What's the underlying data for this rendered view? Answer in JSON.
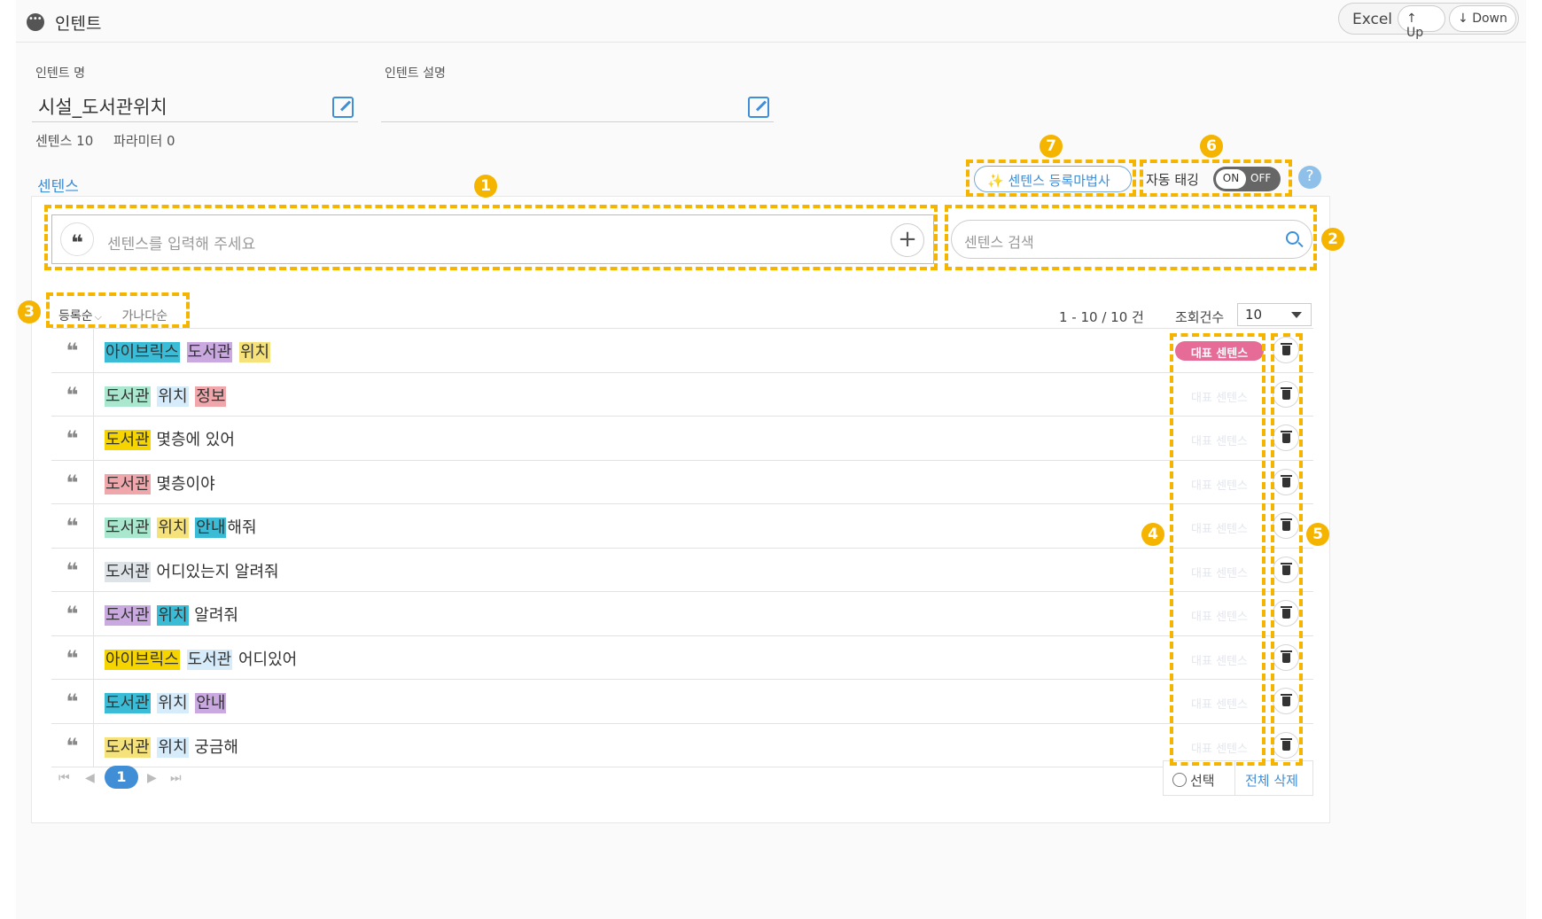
{
  "header": {
    "title": "인텐트",
    "excel_label": "Excel",
    "up_label": "Up",
    "down_label": "Down",
    "up_arrow": "↑",
    "down_arrow": "↓"
  },
  "intent": {
    "name_label": "인텐트 명",
    "name_value": "시설_도서관위치",
    "desc_label": "인텐트 설명",
    "desc_value": "",
    "sentence_count": "센텐스 10",
    "param_count": "파라미터 0"
  },
  "sentences": {
    "section_title": "센텐스",
    "wizard_label": "센텐스 등록마법사",
    "wizard_icon": "✨",
    "auto_tag_label": "자동 태깅",
    "toggle_on": "ON",
    "toggle_off": "OFF",
    "help_glyph": "?",
    "input_placeholder": "센텐스를 입력해 주세요",
    "quote_glyph": "❝",
    "plus_glyph": "+",
    "search_placeholder": "센텐스 검색",
    "sort_primary": "등록순",
    "sort_chevron": "⌵",
    "sort_secondary": "가나다순",
    "range_text": "1 - 10 / 10 건",
    "rows_label": "조회건수",
    "rows_value": "10",
    "rep_badge": "대표 센텐스",
    "rows": [
      {
        "rep": true,
        "segments": [
          {
            "t": "아이브릭스",
            "c": "#3bbcd6"
          },
          {
            "t": " ",
            "c": ""
          },
          {
            "t": "도서관",
            "c": "#c9a9e0"
          },
          {
            "t": " ",
            "c": ""
          },
          {
            "t": "위치",
            "c": "#f5e27a"
          }
        ]
      },
      {
        "rep": false,
        "segments": [
          {
            "t": "도서관",
            "c": "#a9e8cf"
          },
          {
            "t": " ",
            "c": ""
          },
          {
            "t": "위치",
            "c": "#d6ecfb"
          },
          {
            "t": " ",
            "c": ""
          },
          {
            "t": "정보",
            "c": "#f0a7ac"
          }
        ]
      },
      {
        "rep": false,
        "segments": [
          {
            "t": "도서관",
            "c": "#f5d400"
          },
          {
            "t": " 몇층에 있어",
            "c": ""
          }
        ]
      },
      {
        "rep": false,
        "segments": [
          {
            "t": "도서관",
            "c": "#f0a7ac"
          },
          {
            "t": " 몇층이야",
            "c": ""
          }
        ]
      },
      {
        "rep": false,
        "segments": [
          {
            "t": "도서관",
            "c": "#a9e8cf"
          },
          {
            "t": " ",
            "c": ""
          },
          {
            "t": "위치",
            "c": "#f5e27a"
          },
          {
            "t": " ",
            "c": ""
          },
          {
            "t": "안내",
            "c": "#3bbcd6"
          },
          {
            "t": "해줘",
            "c": ""
          }
        ]
      },
      {
        "rep": false,
        "segments": [
          {
            "t": "도서관",
            "c": "#dde3e6"
          },
          {
            "t": " 어디있는지 알려줘",
            "c": ""
          }
        ]
      },
      {
        "rep": false,
        "segments": [
          {
            "t": "도서관",
            "c": "#c9a9e0"
          },
          {
            "t": " ",
            "c": ""
          },
          {
            "t": "위치",
            "c": "#3bbcd6"
          },
          {
            "t": " 알려줘",
            "c": ""
          }
        ]
      },
      {
        "rep": false,
        "segments": [
          {
            "t": "아이브릭스",
            "c": "#f5d400"
          },
          {
            "t": " ",
            "c": ""
          },
          {
            "t": "도서관",
            "c": "#d6ecfb"
          },
          {
            "t": " 어디있어",
            "c": ""
          }
        ]
      },
      {
        "rep": false,
        "segments": [
          {
            "t": "도서관",
            "c": "#3bbcd6"
          },
          {
            "t": " ",
            "c": ""
          },
          {
            "t": "위치",
            "c": "#d6ecfb"
          },
          {
            "t": " ",
            "c": ""
          },
          {
            "t": "안내",
            "c": "#c9a9e0"
          }
        ]
      },
      {
        "rep": false,
        "segments": [
          {
            "t": "도서관",
            "c": "#f5e27a"
          },
          {
            "t": " ",
            "c": ""
          },
          {
            "t": "위치",
            "c": "#d6ecfb"
          },
          {
            "t": " 궁금해",
            "c": ""
          }
        ]
      }
    ],
    "pager": {
      "first": "⏮",
      "prev": "◀",
      "current": "1",
      "next": "▶",
      "last": "⏭"
    },
    "select_label": "선택",
    "delete_all_label": "전체 삭제"
  },
  "annotations": {
    "n1": "1",
    "n2": "2",
    "n3": "3",
    "n4": "4",
    "n5": "5",
    "n6": "6",
    "n7": "7",
    "color": "#f4b400"
  },
  "colors": {
    "accent": "#3f8ed6",
    "rep_badge": "#e66b96"
  }
}
